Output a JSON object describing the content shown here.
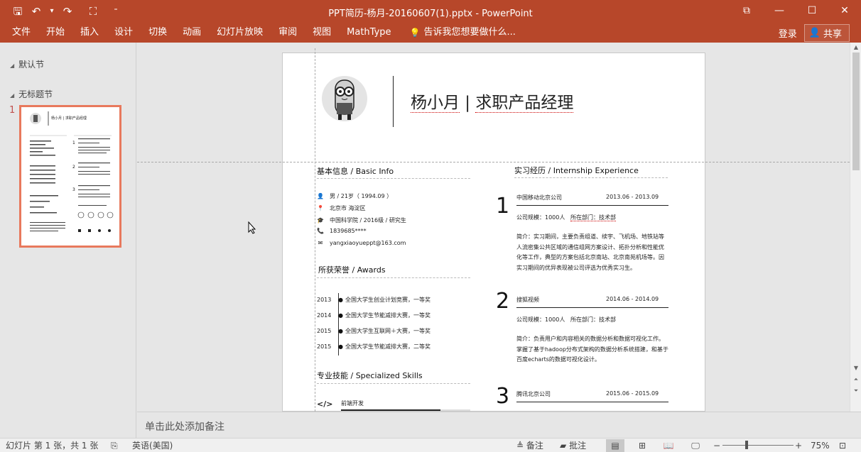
{
  "window": {
    "title": "PPT简历-杨月-20160607(1).pptx - PowerPoint",
    "controls": {
      "restore_layout": "⧉",
      "minimize": "—",
      "maximize": "☐",
      "close": "✕"
    }
  },
  "quick_access": {
    "save": "🖫",
    "undo": "↶",
    "undo_dropdown": "▾",
    "redo": "↷",
    "slideshow": "⛶",
    "customize": "⁼"
  },
  "ribbon": {
    "tabs": [
      "文件",
      "开始",
      "插入",
      "设计",
      "切换",
      "动画",
      "幻灯片放映",
      "审阅",
      "视图",
      "MathType"
    ],
    "tell_me": "告诉我您想要做什么...",
    "login": "登录",
    "share": "共享"
  },
  "thumbs": {
    "section1": "默认节",
    "section2": "无标题节",
    "slide_number": "1",
    "mini_title": "杨小月 | 求职产品经理"
  },
  "slide": {
    "title": "杨小月 | 求职产品经理",
    "title_name": "杨小月",
    "title_sep": " | ",
    "title_role": "求职产品经理",
    "basic": {
      "heading": "基本信息 / Basic Info",
      "rows": [
        {
          "icon": "👤",
          "text": "男 / 21岁（ 1994.09 ）"
        },
        {
          "icon": "📍",
          "text": "北京市 海淀区"
        },
        {
          "icon": "🎓",
          "text": "中国科学院  / 2016级 / 研究生"
        },
        {
          "icon": "📞",
          "text": "1839685****"
        },
        {
          "icon": "✉",
          "text": "yangxiaoyueppt@163.com"
        }
      ]
    },
    "awards": {
      "heading": "所获荣誉 / Awards",
      "rows": [
        {
          "year": "2013",
          "text": "全国大学生创业计划竞赛，一等奖"
        },
        {
          "year": "2014",
          "text": "全国大学生节能减排大赛，一等奖"
        },
        {
          "year": "2015",
          "text": "全国大学生互联网＋大赛，一等奖"
        },
        {
          "year": "2015",
          "text": "全国大学生节能减排大赛，二等奖"
        }
      ]
    },
    "skills": {
      "heading": "专业技能 / Specialized Skills",
      "first_skill": "前端开发",
      "first_icon": "</>",
      "first_level": 0.77
    },
    "internship": {
      "heading": "实习经历 / Internship Experience",
      "items": [
        {
          "num": "1",
          "company": "中国移动北京公司",
          "date": "2013.06 - 2013.09",
          "meta_a": "公司规模：1000人",
          "meta_b": "所在部门：技术部",
          "desc": "简介：实习期间，主要负责组道、续宇、飞机场、地铁站等人流密集公共区域的通信组网方案设计、拓扑分析和性能优化等工作，典型的方案包括北京南站、北京南苑机场等。因实习期间的优异表现被公司评选为优秀实习生。"
        },
        {
          "num": "2",
          "company": "搜狐视频",
          "date": "2014.06 - 2014.09",
          "meta_a": "公司规模：1000人",
          "meta_b": "所在部门：技术部",
          "desc": "简介：负责用户和内容相关的数据分析和数据可视化工作。掌握了基于hadoop分布式架构的数据分析系统搭建，和基于百度echarts的数据可视化设计。"
        },
        {
          "num": "3",
          "company": "腾讯北京公司",
          "date": "2015.06 - 2015.09",
          "meta_a": "",
          "meta_b": "",
          "desc": ""
        }
      ]
    }
  },
  "notes": {
    "placeholder": "单击此处添加备注"
  },
  "status": {
    "slide_info": "幻灯片 第 1 张，共 1 张",
    "language": "英语(美国)",
    "notes_btn": "备注",
    "comments_btn": "批注",
    "zoom": "75%",
    "zoom_minus": "−",
    "zoom_plus": "+"
  },
  "colors": {
    "accent": "#b7472a",
    "thumb_selected": "#e8795d"
  }
}
